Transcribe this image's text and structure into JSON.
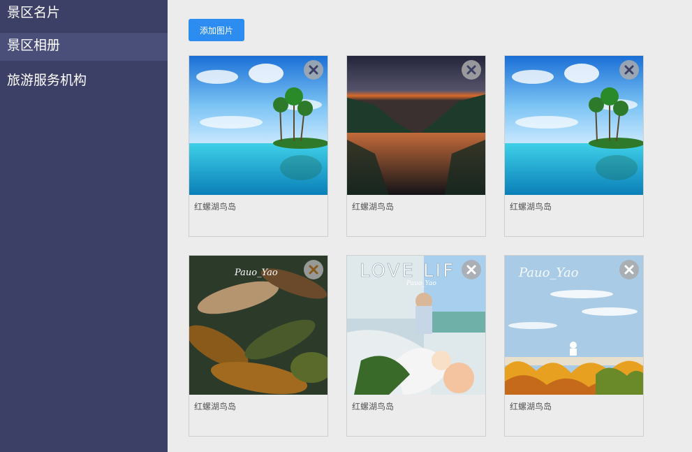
{
  "sidebar": {
    "items": [
      {
        "label": "景区名片"
      },
      {
        "label": "景区相册"
      },
      {
        "label": "旅游服务机构"
      }
    ]
  },
  "toolbar": {
    "add_label": "添加图片"
  },
  "photos": [
    {
      "caption": "红螺湖鸟岛",
      "image": "tropical-island"
    },
    {
      "caption": "红螺湖鸟岛",
      "image": "sunset-river"
    },
    {
      "caption": "红螺湖鸟岛",
      "image": "tropical-island"
    },
    {
      "caption": "红螺湖鸟岛",
      "image": "autumn-leaves-illustration"
    },
    {
      "caption": "红螺湖鸟岛",
      "image": "love-life-illustration"
    },
    {
      "caption": "红螺湖鸟岛",
      "image": "autumn-sky-illustration"
    }
  ],
  "art_text": {
    "signature": "Pauo_Yao",
    "love_life": "LOVE LIF"
  },
  "colors": {
    "sidebar_bg": "#3c4066",
    "sidebar_active": "#4a4f7a",
    "button_blue": "#2d8cf0",
    "page_bg": "#ececec"
  }
}
